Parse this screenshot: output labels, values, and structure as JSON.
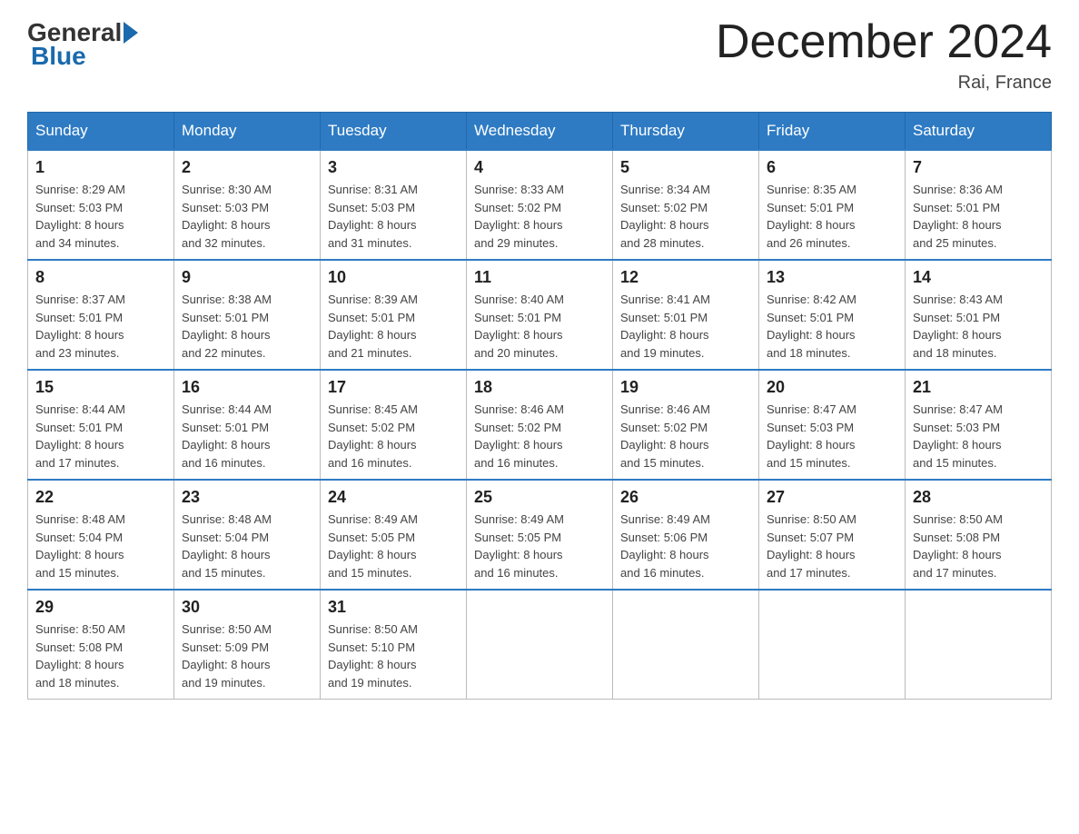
{
  "header": {
    "logo": {
      "general": "General",
      "blue": "Blue"
    },
    "title": "December 2024",
    "location": "Rai, France"
  },
  "days_of_week": [
    "Sunday",
    "Monday",
    "Tuesday",
    "Wednesday",
    "Thursday",
    "Friday",
    "Saturday"
  ],
  "weeks": [
    [
      {
        "day": "1",
        "sunrise": "8:29 AM",
        "sunset": "5:03 PM",
        "daylight": "8 hours and 34 minutes."
      },
      {
        "day": "2",
        "sunrise": "8:30 AM",
        "sunset": "5:03 PM",
        "daylight": "8 hours and 32 minutes."
      },
      {
        "day": "3",
        "sunrise": "8:31 AM",
        "sunset": "5:03 PM",
        "daylight": "8 hours and 31 minutes."
      },
      {
        "day": "4",
        "sunrise": "8:33 AM",
        "sunset": "5:02 PM",
        "daylight": "8 hours and 29 minutes."
      },
      {
        "day": "5",
        "sunrise": "8:34 AM",
        "sunset": "5:02 PM",
        "daylight": "8 hours and 28 minutes."
      },
      {
        "day": "6",
        "sunrise": "8:35 AM",
        "sunset": "5:01 PM",
        "daylight": "8 hours and 26 minutes."
      },
      {
        "day": "7",
        "sunrise": "8:36 AM",
        "sunset": "5:01 PM",
        "daylight": "8 hours and 25 minutes."
      }
    ],
    [
      {
        "day": "8",
        "sunrise": "8:37 AM",
        "sunset": "5:01 PM",
        "daylight": "8 hours and 23 minutes."
      },
      {
        "day": "9",
        "sunrise": "8:38 AM",
        "sunset": "5:01 PM",
        "daylight": "8 hours and 22 minutes."
      },
      {
        "day": "10",
        "sunrise": "8:39 AM",
        "sunset": "5:01 PM",
        "daylight": "8 hours and 21 minutes."
      },
      {
        "day": "11",
        "sunrise": "8:40 AM",
        "sunset": "5:01 PM",
        "daylight": "8 hours and 20 minutes."
      },
      {
        "day": "12",
        "sunrise": "8:41 AM",
        "sunset": "5:01 PM",
        "daylight": "8 hours and 19 minutes."
      },
      {
        "day": "13",
        "sunrise": "8:42 AM",
        "sunset": "5:01 PM",
        "daylight": "8 hours and 18 minutes."
      },
      {
        "day": "14",
        "sunrise": "8:43 AM",
        "sunset": "5:01 PM",
        "daylight": "8 hours and 18 minutes."
      }
    ],
    [
      {
        "day": "15",
        "sunrise": "8:44 AM",
        "sunset": "5:01 PM",
        "daylight": "8 hours and 17 minutes."
      },
      {
        "day": "16",
        "sunrise": "8:44 AM",
        "sunset": "5:01 PM",
        "daylight": "8 hours and 16 minutes."
      },
      {
        "day": "17",
        "sunrise": "8:45 AM",
        "sunset": "5:02 PM",
        "daylight": "8 hours and 16 minutes."
      },
      {
        "day": "18",
        "sunrise": "8:46 AM",
        "sunset": "5:02 PM",
        "daylight": "8 hours and 16 minutes."
      },
      {
        "day": "19",
        "sunrise": "8:46 AM",
        "sunset": "5:02 PM",
        "daylight": "8 hours and 15 minutes."
      },
      {
        "day": "20",
        "sunrise": "8:47 AM",
        "sunset": "5:03 PM",
        "daylight": "8 hours and 15 minutes."
      },
      {
        "day": "21",
        "sunrise": "8:47 AM",
        "sunset": "5:03 PM",
        "daylight": "8 hours and 15 minutes."
      }
    ],
    [
      {
        "day": "22",
        "sunrise": "8:48 AM",
        "sunset": "5:04 PM",
        "daylight": "8 hours and 15 minutes."
      },
      {
        "day": "23",
        "sunrise": "8:48 AM",
        "sunset": "5:04 PM",
        "daylight": "8 hours and 15 minutes."
      },
      {
        "day": "24",
        "sunrise": "8:49 AM",
        "sunset": "5:05 PM",
        "daylight": "8 hours and 15 minutes."
      },
      {
        "day": "25",
        "sunrise": "8:49 AM",
        "sunset": "5:05 PM",
        "daylight": "8 hours and 16 minutes."
      },
      {
        "day": "26",
        "sunrise": "8:49 AM",
        "sunset": "5:06 PM",
        "daylight": "8 hours and 16 minutes."
      },
      {
        "day": "27",
        "sunrise": "8:50 AM",
        "sunset": "5:07 PM",
        "daylight": "8 hours and 17 minutes."
      },
      {
        "day": "28",
        "sunrise": "8:50 AM",
        "sunset": "5:08 PM",
        "daylight": "8 hours and 17 minutes."
      }
    ],
    [
      {
        "day": "29",
        "sunrise": "8:50 AM",
        "sunset": "5:08 PM",
        "daylight": "8 hours and 18 minutes."
      },
      {
        "day": "30",
        "sunrise": "8:50 AM",
        "sunset": "5:09 PM",
        "daylight": "8 hours and 19 minutes."
      },
      {
        "day": "31",
        "sunrise": "8:50 AM",
        "sunset": "5:10 PM",
        "daylight": "8 hours and 19 minutes."
      },
      null,
      null,
      null,
      null
    ]
  ],
  "labels": {
    "sunrise": "Sunrise:",
    "sunset": "Sunset:",
    "daylight": "Daylight:"
  }
}
